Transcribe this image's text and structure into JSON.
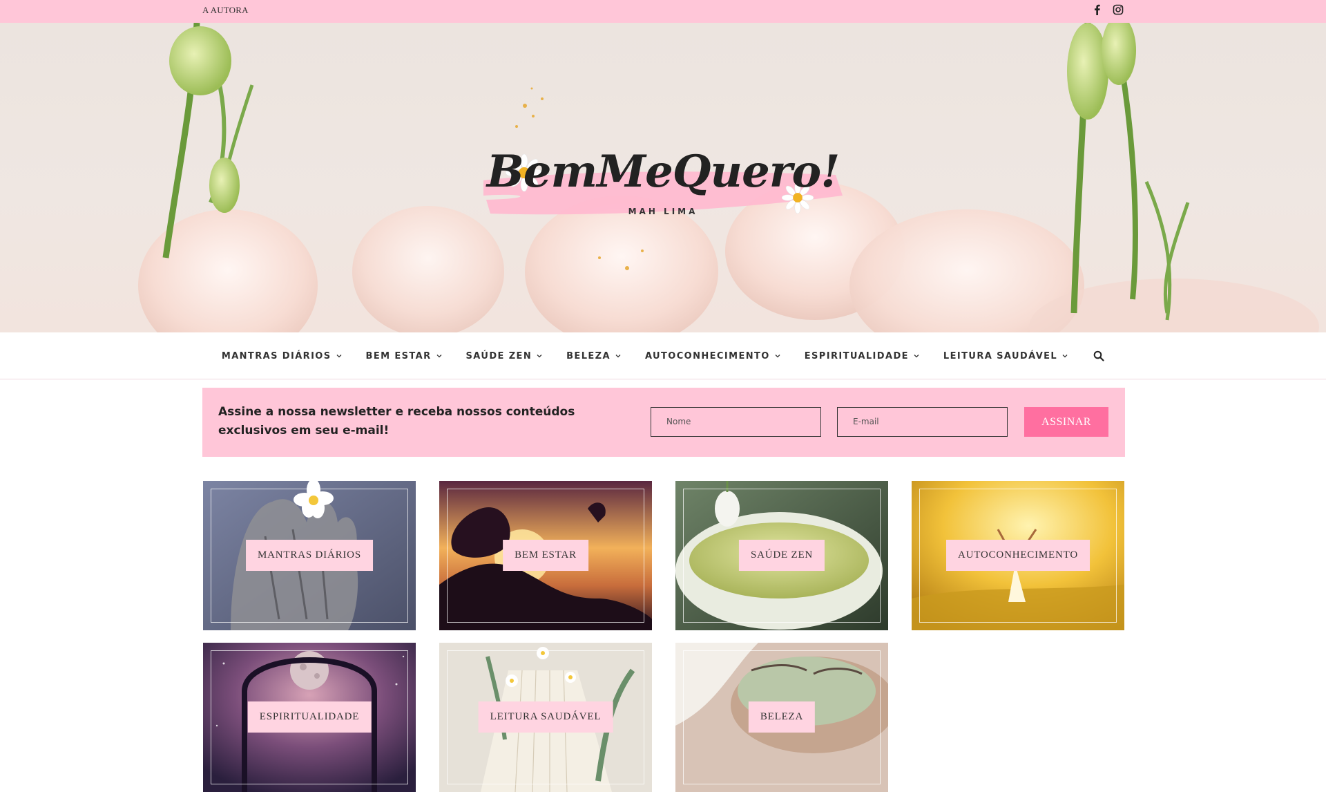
{
  "topbar": {
    "author_link": "A AUTORA",
    "social_icons": [
      "facebook-icon",
      "instagram-icon"
    ]
  },
  "logo": {
    "title": "BemMeQuero!",
    "subtitle": "MAH LIMA"
  },
  "nav": {
    "items": [
      {
        "label": "MANTRAS DIÁRIOS"
      },
      {
        "label": "BEM ESTAR"
      },
      {
        "label": "SAÚDE ZEN"
      },
      {
        "label": "BELEZA"
      },
      {
        "label": "AUTOCONHECIMENTO"
      },
      {
        "label": "ESPIRITUALIDADE"
      },
      {
        "label": "LEITURA SAUDÁVEL"
      }
    ],
    "search_icon": "search-icon"
  },
  "newsletter": {
    "text": "Assine a nossa newsletter e receba nossos conteúdos exclusivos em seu e-mail!",
    "name_placeholder": "Nome",
    "email_placeholder": "E-mail",
    "button": "ASSINAR"
  },
  "categories": [
    {
      "label": "MANTRAS DIÁRIOS"
    },
    {
      "label": "BEM ESTAR"
    },
    {
      "label": "SAÚDE ZEN"
    },
    {
      "label": "AUTOCONHECIMENTO"
    },
    {
      "label": "ESPIRITUALIDADE"
    },
    {
      "label": "LEITURA SAUDÁVEL"
    },
    {
      "label": "BELEZA"
    }
  ],
  "colors": {
    "pink_bar": "#ffc6d8",
    "button_pink": "#ff6fa0",
    "label_pink": "#ffd4e1"
  }
}
